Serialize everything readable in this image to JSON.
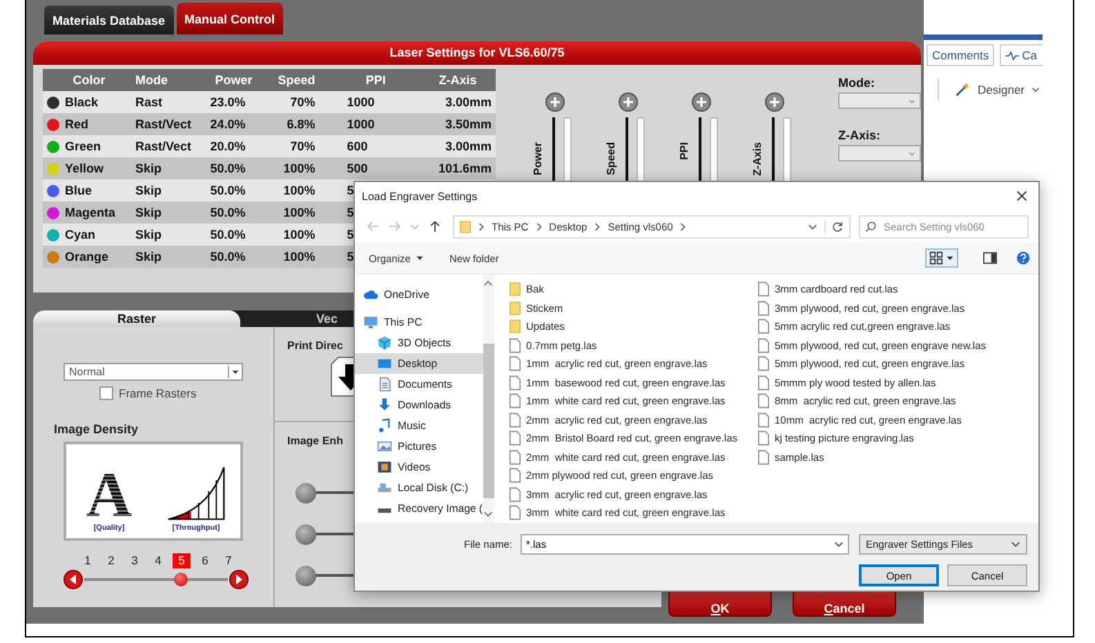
{
  "app_tabs": [
    {
      "label": "Materials Database",
      "selected": false
    },
    {
      "label": "Manual Control",
      "selected": true
    }
  ],
  "laser_panel": {
    "title": "Laser Settings for VLS6.60/75",
    "table": {
      "columns": [
        "Color",
        "Mode",
        "Power",
        "Speed",
        "PPI",
        "Z-Axis"
      ],
      "rows": [
        {
          "color": "#2e2e2e",
          "name": "Black",
          "mode": "Rast",
          "power": "23.0%",
          "speed": "70%",
          "ppi": "1000",
          "z_axis": "3.00mm"
        },
        {
          "color": "#e8141c",
          "name": "Red",
          "mode": "Rast/Vect",
          "power": "24.0%",
          "speed": "6.8%",
          "ppi": "1000",
          "z_axis": "3.50mm"
        },
        {
          "color": "#12b018",
          "name": "Green",
          "mode": "Rast/Vect",
          "power": "20.0%",
          "speed": "70%",
          "ppi": "600",
          "z_axis": "3.00mm"
        },
        {
          "color": "#d8d010",
          "name": "Yellow",
          "mode": "Skip",
          "power": "50.0%",
          "speed": "100%",
          "ppi": "500",
          "z_axis": "101.6mm"
        },
        {
          "color": "#4a5cf0",
          "name": "Blue",
          "mode": "Skip",
          "power": "50.0%",
          "speed": "100%",
          "ppi": "5"
        },
        {
          "color": "#d818d8",
          "name": "Magenta",
          "mode": "Skip",
          "power": "50.0%",
          "speed": "100%",
          "ppi": "5"
        },
        {
          "color": "#10b0b0",
          "name": "Cyan",
          "mode": "Skip",
          "power": "50.0%",
          "speed": "100%",
          "ppi": "5"
        },
        {
          "color": "#d07810",
          "name": "Orange",
          "mode": "Skip",
          "power": "50.0%",
          "speed": "100%",
          "ppi": "5"
        }
      ]
    },
    "sliders": [
      {
        "label": "Power"
      },
      {
        "label": "Speed"
      },
      {
        "label": "PPI"
      },
      {
        "label": "Z-Axis"
      }
    ],
    "mode_label": "Mode:",
    "z_axis_label": "Z-Axis:"
  },
  "settings_tabs": [
    {
      "label": "Raster",
      "selected": true
    },
    {
      "label": "Vec",
      "selected": false
    }
  ],
  "raster": {
    "mode_value": "Normal",
    "frame_rasters": {
      "label": "Frame Rasters",
      "checked": false
    },
    "density_title": "Image Density",
    "quality_glyph": "A",
    "quality_label": "[Quality]",
    "throughput_label": "[Throughput]",
    "density_steps": [
      {
        "label": "1",
        "selected": false
      },
      {
        "label": "2",
        "selected": false
      },
      {
        "label": "3",
        "selected": false
      },
      {
        "label": "4",
        "selected": false
      },
      {
        "label": "5",
        "selected": true
      },
      {
        "label": "6",
        "selected": false
      },
      {
        "label": "7",
        "selected": false
      }
    ],
    "density_slider": {
      "level": 0.67
    }
  },
  "print_direction_title": "Print Direc",
  "image_enhancement_title": "Image Enh",
  "enhancement_sliders": [
    {
      "level": 0
    },
    {
      "level": 0
    },
    {
      "level": 0
    }
  ],
  "buttons": [
    "OK",
    "Cancel"
  ],
  "side_app": {
    "buttons": [
      "Comments",
      "Ca"
    ],
    "designer": "Designer"
  },
  "dialog": {
    "title": "Load Engraver Settings",
    "breadcrumbs": [
      "This PC",
      "Desktop",
      "Setting vls060"
    ],
    "search": {
      "placeholder": "Search Setting vls060"
    },
    "toolbar": [
      "Organize",
      "New folder"
    ],
    "nav": [
      {
        "label": "OneDrive",
        "kind": "cloud",
        "selected": false
      },
      {
        "label": "This PC",
        "kind": "pc",
        "selected": false,
        "children": [
          {
            "label": "3D Objects",
            "kind": "cube",
            "selected": false
          },
          {
            "label": "Desktop",
            "kind": "desktop",
            "selected": true
          },
          {
            "label": "Documents",
            "kind": "document",
            "selected": false
          },
          {
            "label": "Downloads",
            "kind": "download",
            "selected": false
          },
          {
            "label": "Music",
            "kind": "music",
            "selected": false
          },
          {
            "label": "Pictures",
            "kind": "pictures",
            "selected": false
          },
          {
            "label": "Videos",
            "kind": "video",
            "selected": false
          },
          {
            "label": "Local Disk (C:)",
            "kind": "disk",
            "selected": false
          },
          {
            "label": "Recovery Image (",
            "kind": "drive",
            "selected": false
          }
        ]
      }
    ],
    "files": [
      {
        "name": "Bak",
        "kind": "folder"
      },
      {
        "name": "Stickem",
        "kind": "folder"
      },
      {
        "name": "Updates",
        "kind": "folder"
      },
      {
        "name": "0.7mm petg.las",
        "kind": "file"
      },
      {
        "name": "1mm  acrylic red cut, green engrave.las",
        "kind": "file"
      },
      {
        "name": "1mm  basewood red cut, green engrave.las",
        "kind": "file"
      },
      {
        "name": "1mm  white card red cut, green engrave.las",
        "kind": "file"
      },
      {
        "name": "2mm  acrylic red cut, green engrave.las",
        "kind": "file"
      },
      {
        "name": "2mm  Bristol Board red cut, green engrave.las",
        "kind": "file"
      },
      {
        "name": "2mm  white card red cut, green engrave.las",
        "kind": "file"
      },
      {
        "name": "2mm plywood red cut, green engrave.las",
        "kind": "file"
      },
      {
        "name": "3mm  acrylic red cut, green engrave.las",
        "kind": "file"
      },
      {
        "name": "3mm  white card red cut, green engrave.las",
        "kind": "file"
      },
      {
        "name": "3mm cardboard red cut.las",
        "kind": "file"
      },
      {
        "name": "3mm plywood, red cut, green engrave.las",
        "kind": "file"
      },
      {
        "name": "5mm acrylic red cut,green engrave.las",
        "kind": "file"
      },
      {
        "name": "5mm plywood, red cut, green engrave new.las",
        "kind": "file"
      },
      {
        "name": "5mm plywood, red cut, green engrave.las",
        "kind": "file"
      },
      {
        "name": "5mmm ply wood tested by allen.las",
        "kind": "file"
      },
      {
        "name": "8mm  acrylic red cut, green engrave.las",
        "kind": "file"
      },
      {
        "name": "10mm  acrylic red cut, green engrave.las",
        "kind": "file"
      },
      {
        "name": "kj testing picture engraving.las",
        "kind": "file"
      },
      {
        "name": "sample.las",
        "kind": "file"
      }
    ],
    "file_name_label": "File name:",
    "file_name_value": "*.las",
    "file_type": "Engraver Settings Files",
    "buttons": [
      {
        "label": "Open",
        "default": true
      },
      {
        "label": "Cancel",
        "default": false
      }
    ]
  }
}
